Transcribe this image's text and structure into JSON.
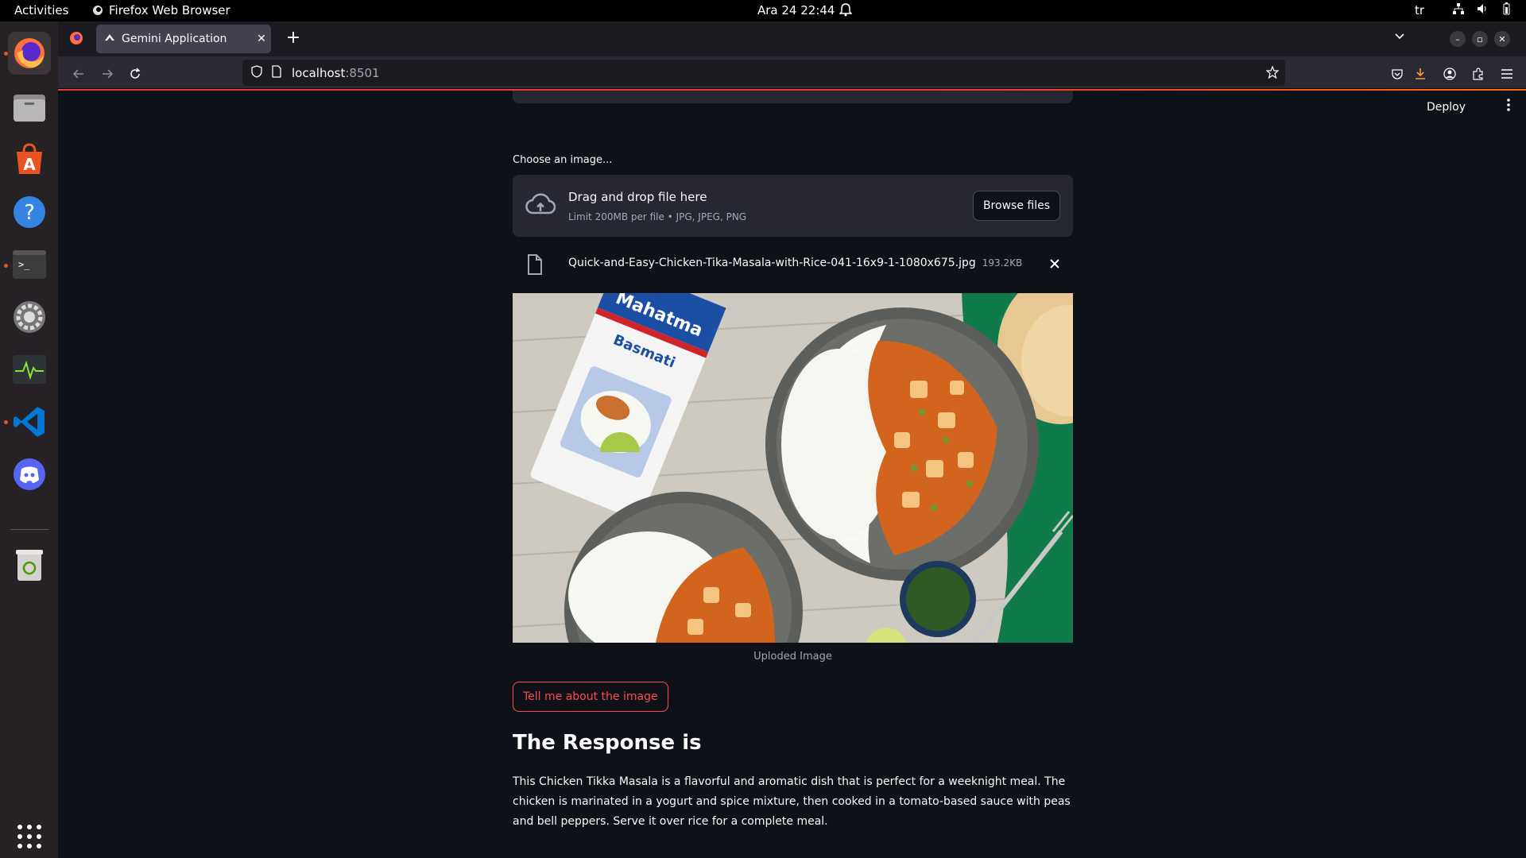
{
  "topbar": {
    "activities": "Activities",
    "app_name": "Firefox Web Browser",
    "clock": "Ara 24  22:44",
    "lang": "tr"
  },
  "dock": {
    "items": [
      "firefox",
      "files",
      "app-center",
      "help",
      "terminal",
      "settings",
      "system-monitor",
      "vscode",
      "discord",
      "trash",
      "show-apps"
    ]
  },
  "browser": {
    "tab_title": "Gemini Application",
    "url_host": "localhost",
    "url_port": ":8501"
  },
  "app": {
    "deploy_label": "Deploy",
    "uploader_label": "Choose an image...",
    "dropzone_title": "Drag and drop file here",
    "dropzone_sub": "Limit 200MB per file • JPG, JPEG, PNG",
    "browse_label": "Browse files",
    "file_name": "Quick-and-Easy-Chicken-Tika-Masala-with-Rice-041-16x9-1-1080x675.jpg",
    "file_size": "193.2KB",
    "image_caption": "Uploded Image",
    "tell_button": "Tell me about the image",
    "response_title": "The Response is",
    "response_text": "This Chicken Tikka Masala is a flavorful and aromatic dish that is perfect for a weeknight meal. The chicken is marinated in a yogurt and spice mixture, then cooked in a tomato-based sauce with peas and bell peppers. Serve it over rice for a complete meal."
  },
  "image_labels": {
    "brand": "Mahatma",
    "product": "Basmati"
  },
  "colors": {
    "accent": "#ff4b4b",
    "page_bg": "#0e1117",
    "panel_bg": "#262730",
    "dock_indicator": "#e95420"
  }
}
